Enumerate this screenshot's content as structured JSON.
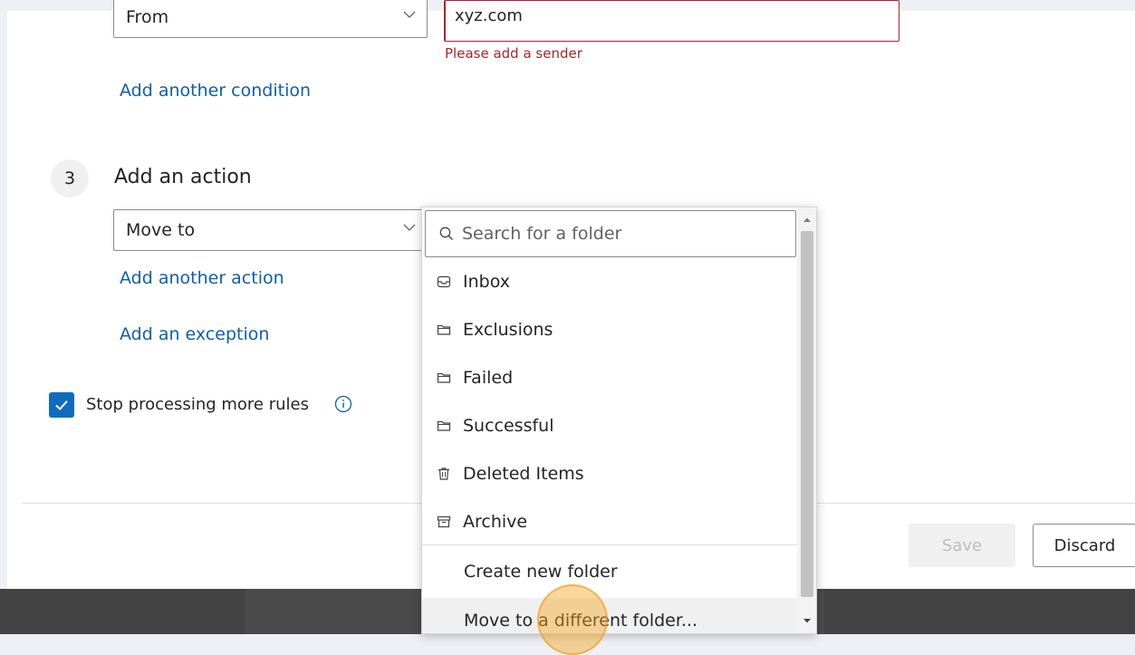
{
  "condition": {
    "field_value": "From",
    "sender_value": "xyz.com",
    "error_text": "Please add a sender",
    "add_condition_link": "Add another condition"
  },
  "action": {
    "step_number": "3",
    "heading": "Add an action",
    "select_value": "Move to",
    "add_action_link": "Add another action",
    "add_exception_link": "Add an exception"
  },
  "stop_processing": {
    "label": "Stop processing more rules",
    "checked": true
  },
  "buttons": {
    "save": "Save",
    "discard": "Discard"
  },
  "folder_dropdown": {
    "search_placeholder": "Search for a folder",
    "folders": [
      {
        "label": "Inbox",
        "icon": "inbox-icon"
      },
      {
        "label": "Exclusions",
        "icon": "folder-icon"
      },
      {
        "label": "Failed",
        "icon": "folder-icon"
      },
      {
        "label": "Successful",
        "icon": "folder-icon"
      },
      {
        "label": "Deleted Items",
        "icon": "trash-icon"
      },
      {
        "label": "Archive",
        "icon": "archive-icon"
      }
    ],
    "create_new": "Create new folder",
    "move_different": "Move to a different folder..."
  },
  "colors": {
    "accent": "#0f6cbd",
    "error": "#a4262c",
    "link": "#115ea3",
    "highlight": "#f5a623"
  }
}
